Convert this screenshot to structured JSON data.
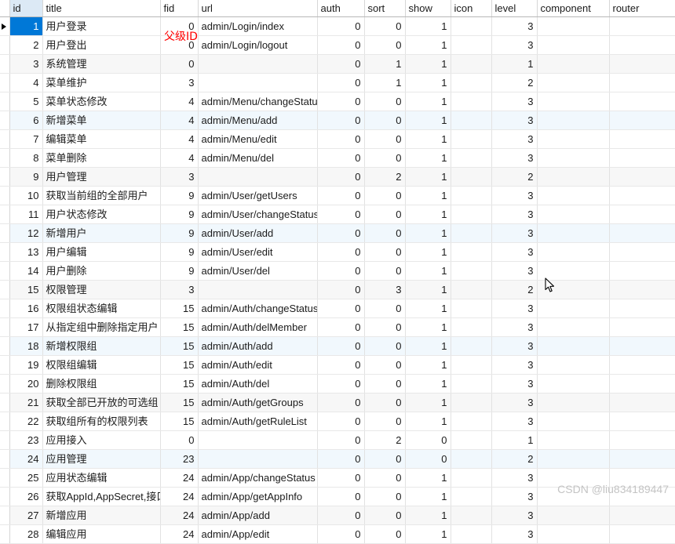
{
  "table": {
    "columns": [
      {
        "key": "id",
        "label": "id",
        "align": "num"
      },
      {
        "key": "title",
        "label": "title",
        "align": "txt"
      },
      {
        "key": "fid",
        "label": "fid",
        "align": "num"
      },
      {
        "key": "url",
        "label": "url",
        "align": "txt"
      },
      {
        "key": "auth",
        "label": "auth",
        "align": "num"
      },
      {
        "key": "sort",
        "label": "sort",
        "align": "num"
      },
      {
        "key": "show",
        "label": "show",
        "align": "num"
      },
      {
        "key": "icon",
        "label": "icon",
        "align": "txt"
      },
      {
        "key": "level",
        "label": "level",
        "align": "num"
      },
      {
        "key": "component",
        "label": "component",
        "align": "txt"
      },
      {
        "key": "router",
        "label": "router",
        "align": "txt"
      }
    ],
    "rows": [
      {
        "id": "1",
        "title": "用户登录",
        "fid": "0",
        "url": "admin/Login/index",
        "auth": "0",
        "sort": "0",
        "show": "1",
        "icon": "",
        "level": "3",
        "component": "",
        "router": ""
      },
      {
        "id": "2",
        "title": "用户登出",
        "fid": "0",
        "url": "admin/Login/logout",
        "auth": "0",
        "sort": "0",
        "show": "1",
        "icon": "",
        "level": "3",
        "component": "",
        "router": ""
      },
      {
        "id": "3",
        "title": "系统管理",
        "fid": "0",
        "url": "",
        "auth": "0",
        "sort": "1",
        "show": "1",
        "icon": "",
        "level": "1",
        "component": "",
        "router": ""
      },
      {
        "id": "4",
        "title": "菜单维护",
        "fid": "3",
        "url": "",
        "auth": "0",
        "sort": "1",
        "show": "1",
        "icon": "",
        "level": "2",
        "component": "",
        "router": ""
      },
      {
        "id": "5",
        "title": "菜单状态修改",
        "fid": "4",
        "url": "admin/Menu/changeStatus",
        "auth": "0",
        "sort": "0",
        "show": "1",
        "icon": "",
        "level": "3",
        "component": "",
        "router": ""
      },
      {
        "id": "6",
        "title": "新增菜单",
        "fid": "4",
        "url": "admin/Menu/add",
        "auth": "0",
        "sort": "0",
        "show": "1",
        "icon": "",
        "level": "3",
        "component": "",
        "router": ""
      },
      {
        "id": "7",
        "title": "编辑菜单",
        "fid": "4",
        "url": "admin/Menu/edit",
        "auth": "0",
        "sort": "0",
        "show": "1",
        "icon": "",
        "level": "3",
        "component": "",
        "router": ""
      },
      {
        "id": "8",
        "title": "菜单删除",
        "fid": "4",
        "url": "admin/Menu/del",
        "auth": "0",
        "sort": "0",
        "show": "1",
        "icon": "",
        "level": "3",
        "component": "",
        "router": ""
      },
      {
        "id": "9",
        "title": "用户管理",
        "fid": "3",
        "url": "",
        "auth": "0",
        "sort": "2",
        "show": "1",
        "icon": "",
        "level": "2",
        "component": "",
        "router": ""
      },
      {
        "id": "10",
        "title": "获取当前组的全部用户",
        "fid": "9",
        "url": "admin/User/getUsers",
        "auth": "0",
        "sort": "0",
        "show": "1",
        "icon": "",
        "level": "3",
        "component": "",
        "router": ""
      },
      {
        "id": "11",
        "title": "用户状态修改",
        "fid": "9",
        "url": "admin/User/changeStatus",
        "auth": "0",
        "sort": "0",
        "show": "1",
        "icon": "",
        "level": "3",
        "component": "",
        "router": ""
      },
      {
        "id": "12",
        "title": "新增用户",
        "fid": "9",
        "url": "admin/User/add",
        "auth": "0",
        "sort": "0",
        "show": "1",
        "icon": "",
        "level": "3",
        "component": "",
        "router": ""
      },
      {
        "id": "13",
        "title": "用户编辑",
        "fid": "9",
        "url": "admin/User/edit",
        "auth": "0",
        "sort": "0",
        "show": "1",
        "icon": "",
        "level": "3",
        "component": "",
        "router": ""
      },
      {
        "id": "14",
        "title": "用户删除",
        "fid": "9",
        "url": "admin/User/del",
        "auth": "0",
        "sort": "0",
        "show": "1",
        "icon": "",
        "level": "3",
        "component": "",
        "router": ""
      },
      {
        "id": "15",
        "title": "权限管理",
        "fid": "3",
        "url": "",
        "auth": "0",
        "sort": "3",
        "show": "1",
        "icon": "",
        "level": "2",
        "component": "",
        "router": ""
      },
      {
        "id": "16",
        "title": "权限组状态编辑",
        "fid": "15",
        "url": "admin/Auth/changeStatus",
        "auth": "0",
        "sort": "0",
        "show": "1",
        "icon": "",
        "level": "3",
        "component": "",
        "router": ""
      },
      {
        "id": "17",
        "title": "从指定组中删除指定用户",
        "fid": "15",
        "url": "admin/Auth/delMember",
        "auth": "0",
        "sort": "0",
        "show": "1",
        "icon": "",
        "level": "3",
        "component": "",
        "router": ""
      },
      {
        "id": "18",
        "title": "新增权限组",
        "fid": "15",
        "url": "admin/Auth/add",
        "auth": "0",
        "sort": "0",
        "show": "1",
        "icon": "",
        "level": "3",
        "component": "",
        "router": ""
      },
      {
        "id": "19",
        "title": "权限组编辑",
        "fid": "15",
        "url": "admin/Auth/edit",
        "auth": "0",
        "sort": "0",
        "show": "1",
        "icon": "",
        "level": "3",
        "component": "",
        "router": ""
      },
      {
        "id": "20",
        "title": "删除权限组",
        "fid": "15",
        "url": "admin/Auth/del",
        "auth": "0",
        "sort": "0",
        "show": "1",
        "icon": "",
        "level": "3",
        "component": "",
        "router": ""
      },
      {
        "id": "21",
        "title": "获取全部已开放的可选组",
        "fid": "15",
        "url": "admin/Auth/getGroups",
        "auth": "0",
        "sort": "0",
        "show": "1",
        "icon": "",
        "level": "3",
        "component": "",
        "router": ""
      },
      {
        "id": "22",
        "title": "获取组所有的权限列表",
        "fid": "15",
        "url": "admin/Auth/getRuleList",
        "auth": "0",
        "sort": "0",
        "show": "1",
        "icon": "",
        "level": "3",
        "component": "",
        "router": ""
      },
      {
        "id": "23",
        "title": "应用接入",
        "fid": "0",
        "url": "",
        "auth": "0",
        "sort": "2",
        "show": "0",
        "icon": "",
        "level": "1",
        "component": "",
        "router": ""
      },
      {
        "id": "24",
        "title": "应用管理",
        "fid": "23",
        "url": "",
        "auth": "0",
        "sort": "0",
        "show": "0",
        "icon": "",
        "level": "2",
        "component": "",
        "router": ""
      },
      {
        "id": "25",
        "title": "应用状态编辑",
        "fid": "24",
        "url": "admin/App/changeStatus",
        "auth": "0",
        "sort": "0",
        "show": "1",
        "icon": "",
        "level": "3",
        "component": "",
        "router": ""
      },
      {
        "id": "26",
        "title": "获取AppId,AppSecret,接口",
        "fid": "24",
        "url": "admin/App/getAppInfo",
        "auth": "0",
        "sort": "0",
        "show": "1",
        "icon": "",
        "level": "3",
        "component": "",
        "router": ""
      },
      {
        "id": "27",
        "title": "新增应用",
        "fid": "24",
        "url": "admin/App/add",
        "auth": "0",
        "sort": "0",
        "show": "1",
        "icon": "",
        "level": "3",
        "component": "",
        "router": ""
      },
      {
        "id": "28",
        "title": "编辑应用",
        "fid": "24",
        "url": "admin/App/edit",
        "auth": "0",
        "sort": "0",
        "show": "1",
        "icon": "",
        "level": "3",
        "component": "",
        "router": ""
      }
    ],
    "selected_row_index": 0,
    "selected_column_key": "id"
  },
  "annotations": [
    {
      "name": "fid-annotation",
      "text": "父级ID",
      "color": "#ff0000"
    }
  ],
  "watermark": {
    "text": "CSDN @liu834189447",
    "color": "#c4c4c4"
  },
  "colors": {
    "selection": "#0078d7",
    "header_selected": "#dce9f5",
    "stripe_gray": "#f7f7f7",
    "stripe_blue": "#f1f8fd",
    "grid_line": "#e2e2e2"
  }
}
